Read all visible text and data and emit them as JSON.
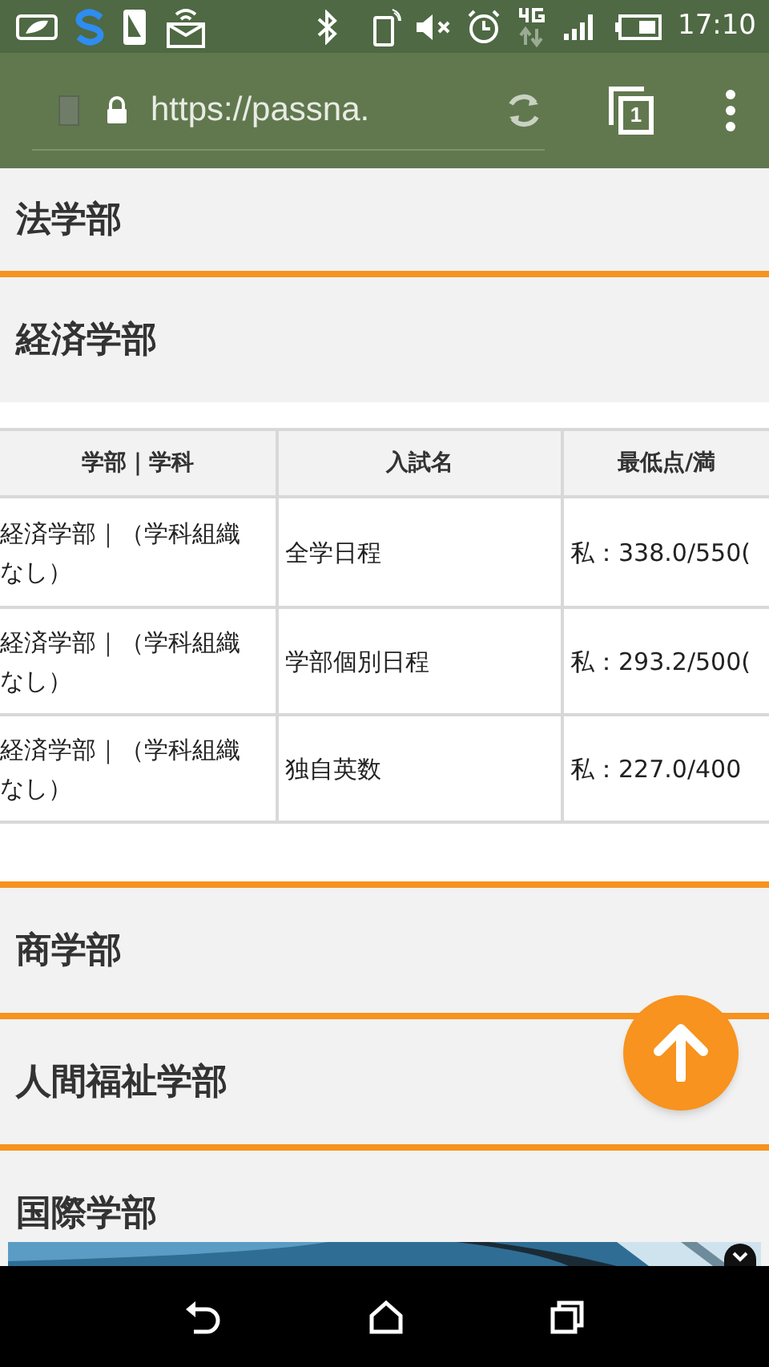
{
  "status_bar": {
    "time": "17:10"
  },
  "browser": {
    "url": "https://passna.",
    "tab_count": "1"
  },
  "sections": [
    {
      "title": "法学部"
    },
    {
      "title": "経済学部",
      "table": {
        "columns": [
          "学部｜学科",
          "入試名",
          "最低点/満"
        ],
        "rows": [
          [
            "経済学部｜（学科組織なし）",
            "全学日程",
            "私：338.0/550("
          ],
          [
            "経済学部｜（学科組織なし）",
            "学部個別日程",
            "私：293.2/500("
          ],
          [
            "経済学部｜（学科組織なし）",
            "独自英数",
            "私：227.0/400"
          ]
        ]
      }
    },
    {
      "title": "商学部"
    },
    {
      "title": "人間福祉学部"
    },
    {
      "title": "国際学部"
    }
  ]
}
